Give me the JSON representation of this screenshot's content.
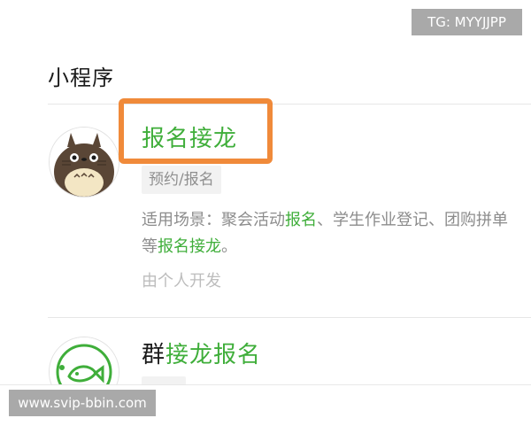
{
  "section": {
    "title": "小程序"
  },
  "results": [
    {
      "title": "报名接龙",
      "tag": "预约/报名",
      "desc_prefix": "适用场景：聚会活动",
      "desc_hl1": "报名",
      "desc_mid": "、学生作业登记、团购拼单等",
      "desc_hl2": "报名接龙",
      "desc_suffix": "。",
      "developer": "由个人开发",
      "avatar_icon": "totoro-avatar-icon"
    },
    {
      "title_prefix": "群",
      "title_hl": "接龙报名",
      "avatar_icon": "fish-avatar-icon"
    }
  ],
  "watermarks": {
    "tg": "TG: MYYJJPP",
    "url": "www.svip-bbin.com"
  },
  "colors": {
    "accent_green": "#3fae3a",
    "highlight_orange": "#f08a3a",
    "watermark_gray": "#a9a9a9"
  }
}
